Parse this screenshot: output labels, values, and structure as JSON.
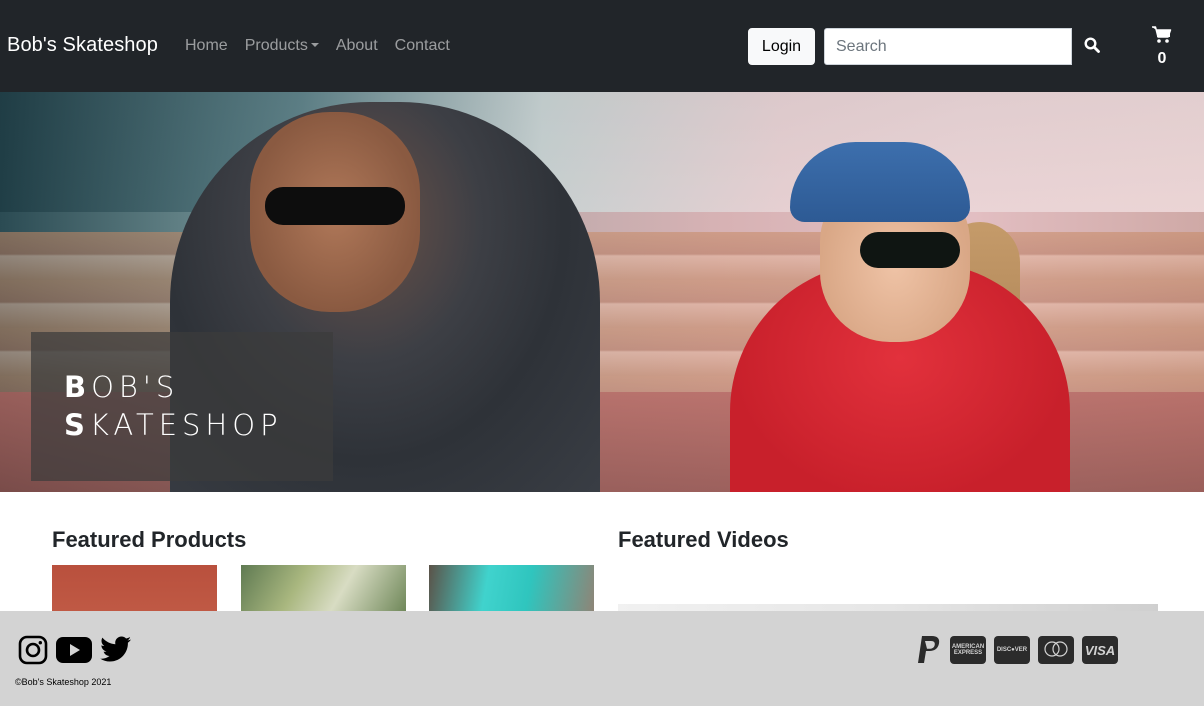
{
  "navbar": {
    "brand": "Bob's Skateshop",
    "links": [
      "Home",
      "Products",
      "About",
      "Contact"
    ],
    "login_label": "Login",
    "search_placeholder": "Search",
    "cart_count": "0"
  },
  "hero": {
    "line1_initial": "B",
    "line1_rest": "OB'S",
    "line2_initial": "S",
    "line2_rest": "KATESHOP"
  },
  "sections": {
    "featured_products": "Featured Products",
    "featured_videos": "Featured Videos"
  },
  "footer": {
    "copyright": "©Bob's Skateshop 2021",
    "payments": [
      "paypal-icon",
      "amex-icon",
      "discover-icon",
      "mastercard-icon",
      "visa-icon"
    ],
    "social": [
      "instagram-icon",
      "youtube-icon",
      "twitter-icon"
    ],
    "visa_label": "VISA"
  }
}
